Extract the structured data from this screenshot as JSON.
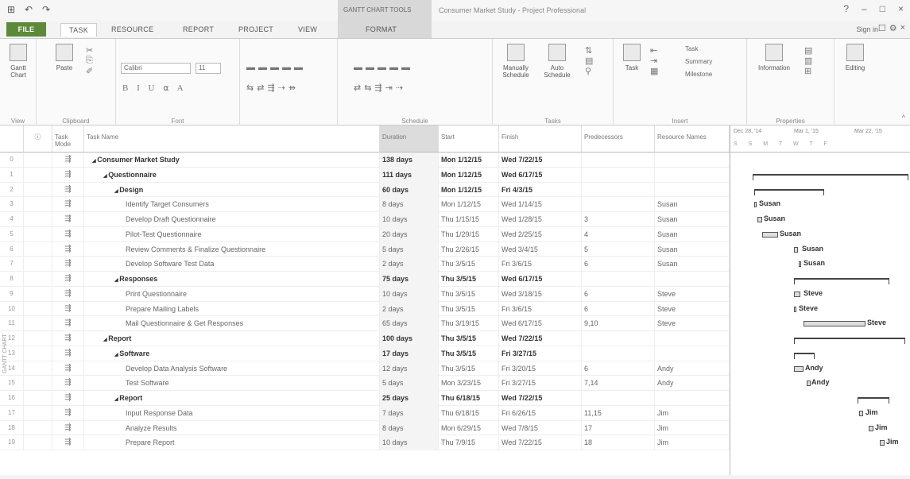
{
  "titlebar": {
    "qat_icons": [
      "save-icon",
      "undo-icon",
      "redo-icon"
    ],
    "context_tab_group": "GANTT CHART TOOLS",
    "title": "Consumer Market Study - Project Professional",
    "controls": [
      "?",
      "–",
      "□",
      "×"
    ]
  },
  "tabs": {
    "file": "FILE",
    "items": [
      "TASK",
      "RESOURCE",
      "REPORT",
      "PROJECT",
      "VIEW"
    ],
    "format": "FORMAT",
    "signin": "Sign in"
  },
  "ribbon": {
    "groups": [
      {
        "label": "View",
        "buttons": [
          "Gantt Chart"
        ]
      },
      {
        "label": "Clipboard",
        "buttons": [
          "Paste"
        ]
      },
      {
        "label": "Font",
        "font_name": "Calibri",
        "font_size": "11"
      },
      {
        "label": "Schedule"
      },
      {
        "label": "Tasks",
        "buttons": [
          "Manually Schedule",
          "Auto Schedule"
        ]
      },
      {
        "label": "Insert",
        "buttons": [
          "Task",
          "Task",
          "Summary",
          "Milestone"
        ]
      },
      {
        "label": "Properties",
        "buttons": [
          "Information"
        ]
      },
      {
        "label": "",
        "buttons": [
          "Editing"
        ]
      }
    ]
  },
  "table": {
    "headers": {
      "info": "",
      "mode": "Task Mode",
      "name": "Task Name",
      "duration": "Duration",
      "start": "Start",
      "finish": "Finish",
      "pred": "Predecessors",
      "res": "Resource Names"
    },
    "rows": [
      {
        "id": "0",
        "name": "Consumer Market Study",
        "dur": "138 days",
        "start": "Mon 1/12/15",
        "finish": "Wed 7/22/15",
        "pred": "",
        "res": "",
        "level": 0,
        "summary": true
      },
      {
        "id": "1",
        "name": "Questionnaire",
        "dur": "111 days",
        "start": "Mon 1/12/15",
        "finish": "Wed 6/17/15",
        "pred": "",
        "res": "",
        "level": 1,
        "summary": true
      },
      {
        "id": "2",
        "name": "Design",
        "dur": "60 days",
        "start": "Mon 1/12/15",
        "finish": "Fri 4/3/15",
        "pred": "",
        "res": "",
        "level": 2,
        "summary": true
      },
      {
        "id": "3",
        "name": "Identify Target Consumers",
        "dur": "8 days",
        "start": "Mon 1/12/15",
        "finish": "Wed 1/14/15",
        "pred": "",
        "res": "Susan",
        "level": 3
      },
      {
        "id": "4",
        "name": "Develop Draft Questionnaire",
        "dur": "10 days",
        "start": "Thu 1/15/15",
        "finish": "Wed 1/28/15",
        "pred": "3",
        "res": "Susan",
        "level": 3
      },
      {
        "id": "5",
        "name": "Pilot-Test Questionnaire",
        "dur": "20 days",
        "start": "Thu 1/29/15",
        "finish": "Wed 2/25/15",
        "pred": "4",
        "res": "Susan",
        "level": 3
      },
      {
        "id": "6",
        "name": "Review Comments & Finalize Questionnaire",
        "dur": "5 days",
        "start": "Thu 2/26/15",
        "finish": "Wed 3/4/15",
        "pred": "5",
        "res": "Susan",
        "level": 3
      },
      {
        "id": "7",
        "name": "Develop Software Test Data",
        "dur": "2 days",
        "start": "Thu 3/5/15",
        "finish": "Fri 3/6/15",
        "pred": "6",
        "res": "Susan",
        "level": 3
      },
      {
        "id": "8",
        "name": "Responses",
        "dur": "75 days",
        "start": "Thu 3/5/15",
        "finish": "Wed 6/17/15",
        "pred": "",
        "res": "",
        "level": 2,
        "summary": true
      },
      {
        "id": "9",
        "name": "Print Questionnaire",
        "dur": "10 days",
        "start": "Thu 3/5/15",
        "finish": "Wed 3/18/15",
        "pred": "6",
        "res": "Steve",
        "level": 3
      },
      {
        "id": "10",
        "name": "Prepare Mailing Labels",
        "dur": "2 days",
        "start": "Thu 3/5/15",
        "finish": "Fri 3/6/15",
        "pred": "6",
        "res": "Steve",
        "level": 3
      },
      {
        "id": "11",
        "name": "Mail Questionnaire & Get Responses",
        "dur": "65 days",
        "start": "Thu 3/19/15",
        "finish": "Wed 6/17/15",
        "pred": "9,10",
        "res": "Steve",
        "level": 3
      },
      {
        "id": "12",
        "name": "Report",
        "dur": "100 days",
        "start": "Thu 3/5/15",
        "finish": "Wed 7/22/15",
        "pred": "",
        "res": "",
        "level": 1,
        "summary": true
      },
      {
        "id": "13",
        "name": "Software",
        "dur": "17 days",
        "start": "Thu 3/5/15",
        "finish": "Fri 3/27/15",
        "pred": "",
        "res": "",
        "level": 2,
        "summary": true
      },
      {
        "id": "14",
        "name": "Develop Data Analysis Software",
        "dur": "12 days",
        "start": "Thu 3/5/15",
        "finish": "Fri 3/20/15",
        "pred": "6",
        "res": "Andy",
        "level": 3
      },
      {
        "id": "15",
        "name": "Test Software",
        "dur": "5 days",
        "start": "Mon 3/23/15",
        "finish": "Fri 3/27/15",
        "pred": "7,14",
        "res": "Andy",
        "level": 3
      },
      {
        "id": "16",
        "name": "Report",
        "dur": "25 days",
        "start": "Thu 6/18/15",
        "finish": "Wed 7/22/15",
        "pred": "",
        "res": "",
        "level": 2,
        "summary": true
      },
      {
        "id": "17",
        "name": "Input Response Data",
        "dur": "7 days",
        "start": "Thu 6/18/15",
        "finish": "Fri 6/26/15",
        "pred": "11,15",
        "res": "Jim",
        "level": 3
      },
      {
        "id": "18",
        "name": "Analyze Results",
        "dur": "8 days",
        "start": "Mon 6/29/15",
        "finish": "Wed 7/8/15",
        "pred": "17",
        "res": "Jim",
        "level": 3
      },
      {
        "id": "19",
        "name": "Prepare Report",
        "dur": "10 days",
        "start": "Thu 7/9/15",
        "finish": "Wed 7/22/15",
        "pred": "18",
        "res": "Jim",
        "level": 3
      }
    ]
  },
  "gantt": {
    "timescale_weeks": [
      "Dec 28, '14",
      "Mar 1, '15",
      "Mar 22, '15"
    ],
    "timescale_days": "S S M T W T F",
    "labels": [
      "Susan",
      "Susan",
      "Susan",
      "Susan",
      "Susan",
      "Steve",
      "Steve",
      "Steve",
      "Andy",
      "Andy",
      "Jim",
      "Jim",
      "Jim"
    ],
    "side_label": "GANTT CHART"
  }
}
